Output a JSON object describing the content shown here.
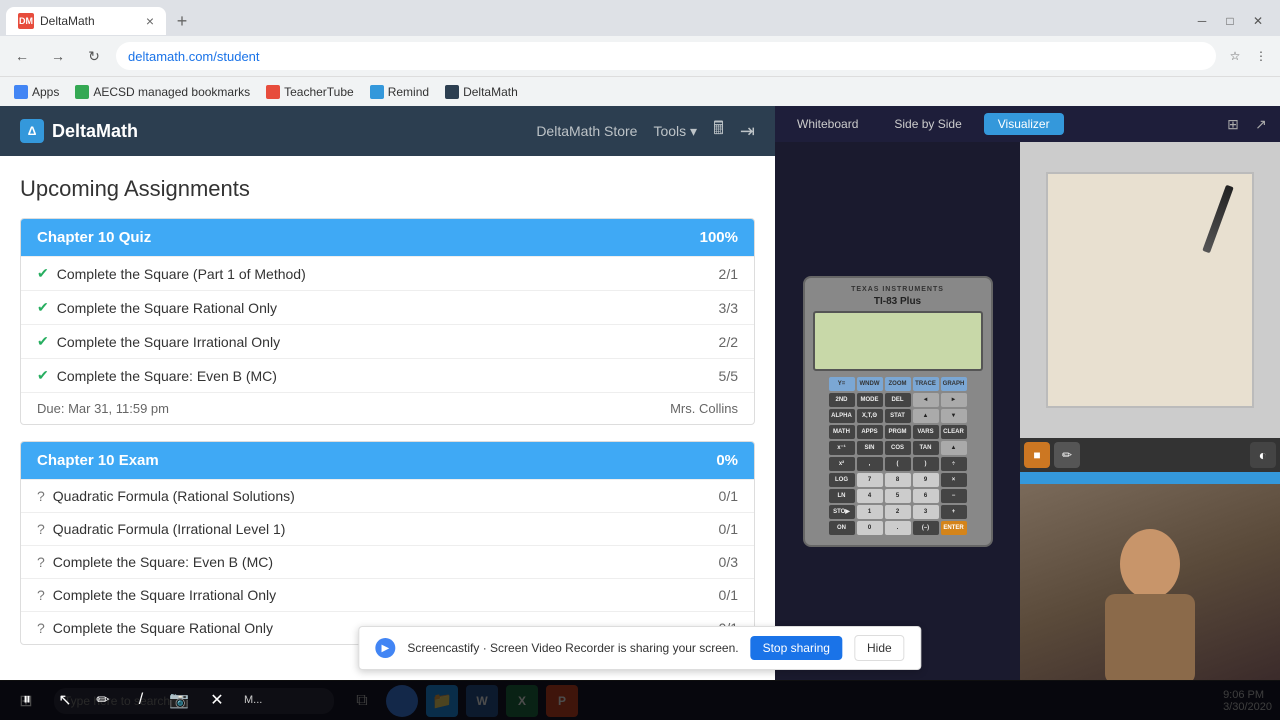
{
  "browser": {
    "tab": {
      "favicon": "DM",
      "title": "DeltaMath",
      "close": "×",
      "new_tab": "+"
    },
    "window_controls": [
      "—",
      "□",
      "×"
    ],
    "address": "deltamath.com/student",
    "bookmarks": [
      {
        "icon": "A",
        "label": "Apps"
      },
      {
        "icon": "A",
        "label": "AECSD managed bookmarks"
      },
      {
        "icon": "T",
        "label": "TeacherTube"
      },
      {
        "icon": "R",
        "label": "Remind"
      },
      {
        "icon": "D",
        "label": "DeltaMath"
      }
    ]
  },
  "deltamath": {
    "logo": "DeltaMath",
    "nav": {
      "store": "DeltaMath Store",
      "tools": "Tools ▾",
      "calc_icon": "🖩",
      "logout_icon": "⇥"
    },
    "page_title": "Upcoming Assignments",
    "assignments": [
      {
        "title": "Chapter 10 Quiz",
        "percent": "100%",
        "color": "blue",
        "items": [
          {
            "status": "check",
            "name": "Complete the Square (Part 1 of Method)",
            "score": "2/1"
          },
          {
            "status": "check",
            "name": "Complete the Square Rational Only",
            "score": "3/3"
          },
          {
            "status": "check",
            "name": "Complete the Square Irrational Only",
            "score": "2/2"
          },
          {
            "status": "check",
            "name": "Complete the Square: Even B (MC)",
            "score": "5/5"
          }
        ],
        "due": "Due: Mar 31, 11:59 pm",
        "teacher": "Mrs. Collins"
      },
      {
        "title": "Chapter 10 Exam",
        "percent": "0%",
        "color": "blue",
        "items": [
          {
            "status": "question",
            "name": "Quadratic Formula (Rational Solutions)",
            "score": "0/1"
          },
          {
            "status": "question",
            "name": "Quadratic Formula (Irrational Level 1)",
            "score": "0/1"
          },
          {
            "status": "question",
            "name": "Complete the Square: Even B (MC)",
            "score": "0/3"
          },
          {
            "status": "question",
            "name": "Complete the Square Irrational Only",
            "score": "0/1"
          },
          {
            "status": "question",
            "name": "Complete the Square Rational Only",
            "score": "0/1"
          }
        ],
        "due": "",
        "teacher": ""
      }
    ]
  },
  "right_panel": {
    "view_buttons": [
      "Whiteboard",
      "Side by Side",
      "Visualizer"
    ],
    "active_view": "Visualizer"
  },
  "calculator": {
    "brand": "TEXAS INSTRUMENTS",
    "model": "TI-83 Plus"
  },
  "screencastify": {
    "message": "Screencastify · Screen Video Recorder is sharing your screen.",
    "stop_sharing": "Stop sharing",
    "hide": "Hide"
  },
  "toolbar": {
    "pause_icon": "⏸",
    "cursor_icon": "↖",
    "pen_icon": "✏",
    "line_icon": "/",
    "camera_icon": "📷",
    "close_icon": "✕",
    "text": "M..."
  },
  "taskbar": {
    "search_placeholder": "Type here to search",
    "apps": [
      "⊞",
      "🌐",
      "📁",
      "⚙"
    ],
    "time": "9:06 PM",
    "date": "3/30/2020"
  }
}
